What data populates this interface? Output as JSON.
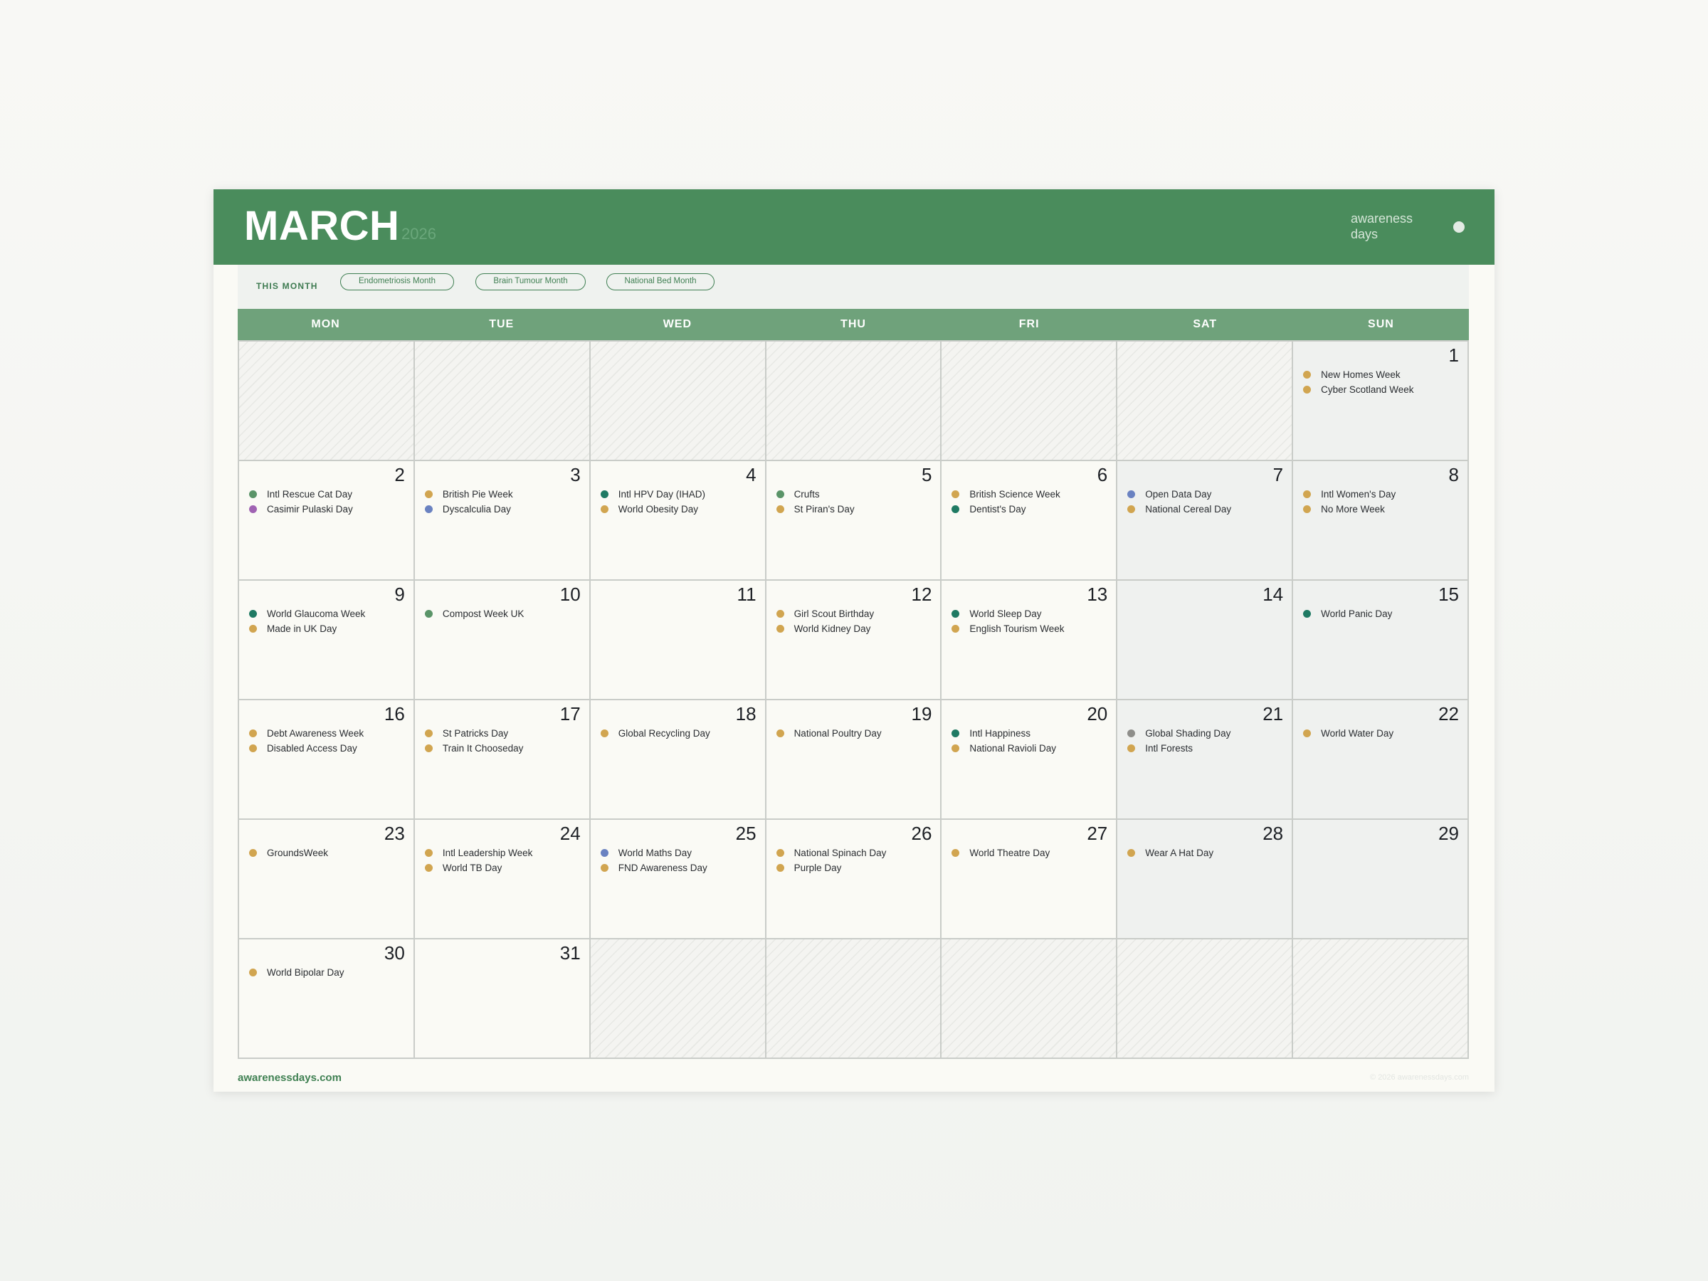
{
  "header": {
    "month": "MARCH",
    "year": "2026",
    "brand": "awareness days"
  },
  "this_month": {
    "label": "THIS MONTH",
    "pills": [
      "Endometriosis Month",
      "Brain Tumour Month",
      "National Bed Month"
    ]
  },
  "weekdays": [
    "MON",
    "TUE",
    "WED",
    "THU",
    "FRI",
    "SAT",
    "SUN"
  ],
  "colors": {
    "green": "#5a9468",
    "teal": "#1f7a63",
    "gold": "#d1a550",
    "blue": "#6a82c1",
    "purple": "#a063b3",
    "grey": "#8e8e8a"
  },
  "weeks": [
    [
      {
        "day": ""
      },
      {
        "day": ""
      },
      {
        "day": ""
      },
      {
        "day": ""
      },
      {
        "day": ""
      },
      {
        "day": ""
      },
      {
        "day": "1",
        "events": [
          {
            "name": "New Homes Week",
            "color": "gold"
          },
          {
            "name": "Cyber Scotland Week",
            "color": "gold"
          }
        ]
      }
    ],
    [
      {
        "day": "2",
        "events": [
          {
            "name": "Intl Rescue Cat Day",
            "color": "green"
          },
          {
            "name": "Casimir Pulaski Day",
            "color": "purple"
          }
        ]
      },
      {
        "day": "3",
        "events": [
          {
            "name": "British Pie Week",
            "color": "gold"
          },
          {
            "name": "Dyscalculia Day",
            "color": "blue"
          }
        ]
      },
      {
        "day": "4",
        "events": [
          {
            "name": "Intl HPV Day (IHAD)",
            "color": "teal"
          },
          {
            "name": "World Obesity Day",
            "color": "gold"
          }
        ]
      },
      {
        "day": "5",
        "events": [
          {
            "name": "Crufts",
            "color": "green"
          },
          {
            "name": "St Piran's Day",
            "color": "gold"
          }
        ]
      },
      {
        "day": "6",
        "events": [
          {
            "name": "British Science Week",
            "color": "gold"
          },
          {
            "name": "Dentist's Day",
            "color": "teal"
          }
        ]
      },
      {
        "day": "7",
        "events": [
          {
            "name": "Open Data Day",
            "color": "blue"
          },
          {
            "name": "National Cereal Day",
            "color": "gold"
          }
        ]
      },
      {
        "day": "8",
        "events": [
          {
            "name": "Intl Women's Day",
            "color": "gold"
          },
          {
            "name": "No More Week",
            "color": "gold"
          }
        ]
      }
    ],
    [
      {
        "day": "9",
        "events": [
          {
            "name": "World Glaucoma Week",
            "color": "teal"
          },
          {
            "name": "Made in UK Day",
            "color": "gold"
          }
        ]
      },
      {
        "day": "10",
        "events": [
          {
            "name": "Compost Week UK",
            "color": "green"
          }
        ]
      },
      {
        "day": "11",
        "events": []
      },
      {
        "day": "12",
        "events": [
          {
            "name": "Girl Scout Birthday",
            "color": "gold"
          },
          {
            "name": "World Kidney Day",
            "color": "gold"
          }
        ]
      },
      {
        "day": "13",
        "events": [
          {
            "name": "World Sleep Day",
            "color": "teal"
          },
          {
            "name": "English Tourism Week",
            "color": "gold"
          }
        ]
      },
      {
        "day": "14",
        "events": []
      },
      {
        "day": "15",
        "events": [
          {
            "name": "World Panic Day",
            "color": "teal"
          }
        ]
      }
    ],
    [
      {
        "day": "16",
        "events": [
          {
            "name": "Debt Awareness Week",
            "color": "gold"
          },
          {
            "name": "Disabled Access Day",
            "color": "gold"
          }
        ]
      },
      {
        "day": "17",
        "events": [
          {
            "name": "St Patricks Day",
            "color": "gold"
          },
          {
            "name": "Train It Chooseday",
            "color": "gold"
          }
        ]
      },
      {
        "day": "18",
        "events": [
          {
            "name": "Global Recycling Day",
            "color": "gold"
          }
        ]
      },
      {
        "day": "19",
        "events": [
          {
            "name": "National Poultry Day",
            "color": "gold"
          }
        ]
      },
      {
        "day": "20",
        "events": [
          {
            "name": "Intl Happiness",
            "color": "teal"
          },
          {
            "name": "National Ravioli Day",
            "color": "gold"
          }
        ]
      },
      {
        "day": "21",
        "events": [
          {
            "name": "Global Shading Day",
            "color": "grey"
          },
          {
            "name": "Intl Forests",
            "color": "gold"
          }
        ]
      },
      {
        "day": "22",
        "events": [
          {
            "name": "World Water Day",
            "color": "gold"
          }
        ]
      }
    ],
    [
      {
        "day": "23",
        "events": [
          {
            "name": "GroundsWeek",
            "color": "gold"
          }
        ]
      },
      {
        "day": "24",
        "events": [
          {
            "name": "Intl Leadership Week",
            "color": "gold"
          },
          {
            "name": "World TB Day",
            "color": "gold"
          }
        ]
      },
      {
        "day": "25",
        "events": [
          {
            "name": "World Maths Day",
            "color": "blue"
          },
          {
            "name": "FND Awareness Day",
            "color": "gold"
          }
        ]
      },
      {
        "day": "26",
        "events": [
          {
            "name": "National Spinach Day",
            "color": "gold"
          },
          {
            "name": "Purple Day",
            "color": "gold"
          }
        ]
      },
      {
        "day": "27",
        "events": [
          {
            "name": "World Theatre Day",
            "color": "gold"
          }
        ]
      },
      {
        "day": "28",
        "events": [
          {
            "name": "Wear A Hat Day",
            "color": "gold"
          }
        ]
      },
      {
        "day": "29",
        "events": []
      }
    ],
    [
      {
        "day": "30",
        "events": [
          {
            "name": "World Bipolar Day",
            "color": "gold"
          }
        ]
      },
      {
        "day": "31",
        "events": []
      },
      {
        "day": ""
      },
      {
        "day": ""
      },
      {
        "day": ""
      },
      {
        "day": ""
      },
      {
        "day": ""
      }
    ]
  ],
  "footer": {
    "site": "awarenessdays.com",
    "copyright": "© 2026 awarenessdays.com"
  }
}
